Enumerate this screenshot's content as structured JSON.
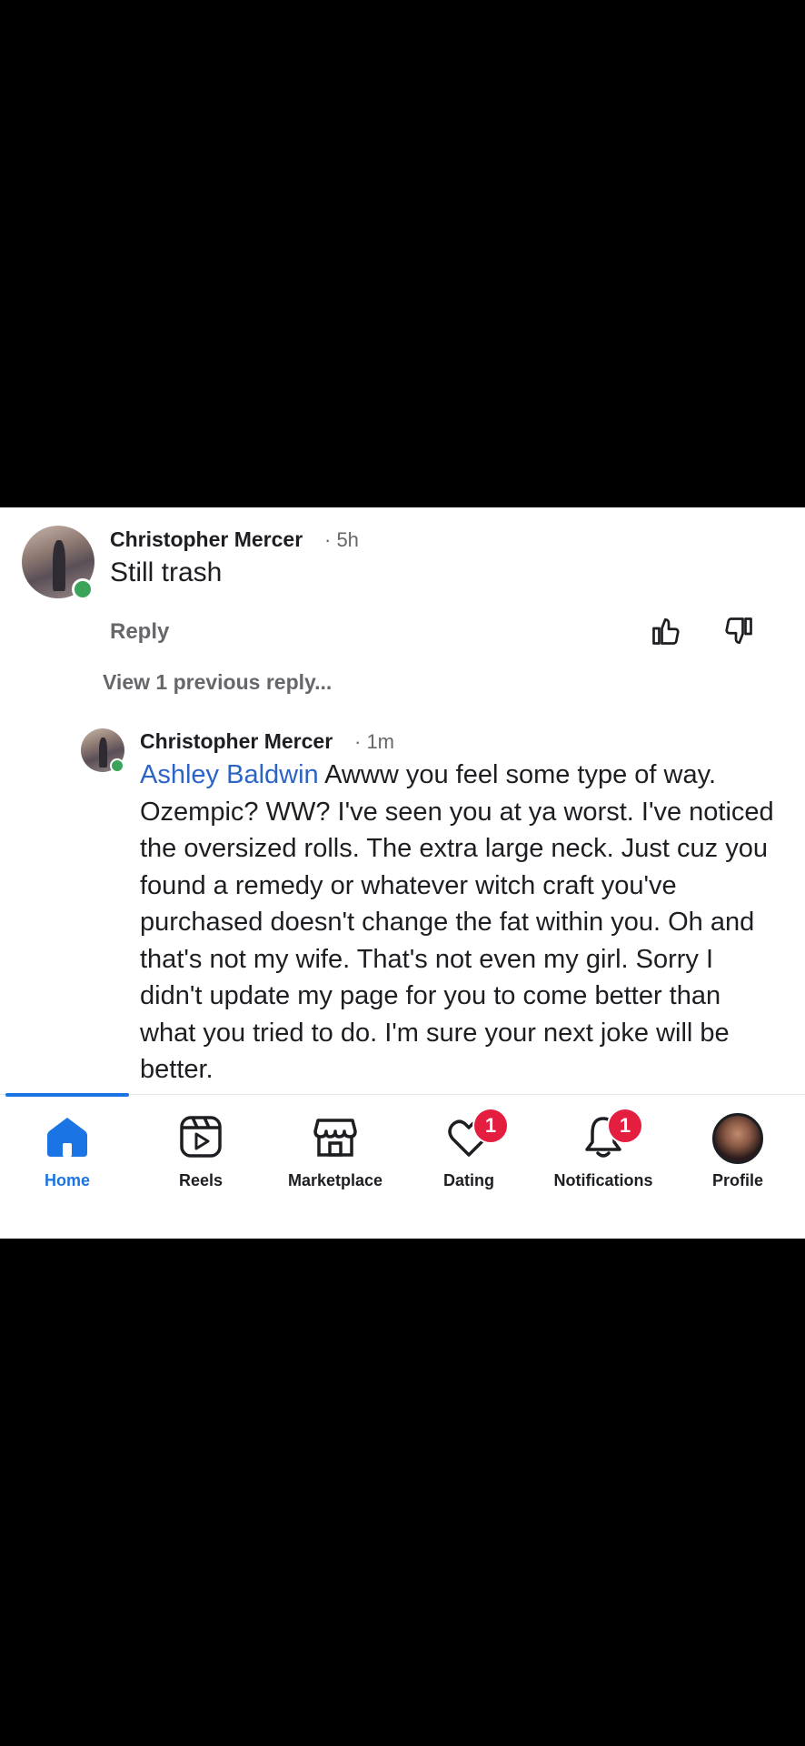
{
  "comment1": {
    "author": "Christopher Mercer",
    "time": "· 5h",
    "text": "Still trash",
    "reply_label": "Reply"
  },
  "view_previous": "View 1 previous reply...",
  "comment2": {
    "author": "Christopher Mercer",
    "time": "· 1m",
    "mention": "Ashley Baldwin",
    "text": " Awww you feel some type of way. Ozempic? WW? I've seen you at ya worst. I've noticed the oversized rolls. The extra large neck. Just cuz you found a remedy or whatever witch craft you've purchased doesn't change the fat within you.  Oh and that's not my wife. That's not even my girl. Sorry I didn't update my page for you to come better than what you tried to do. I'm sure your next joke will be better."
  },
  "nav": {
    "items": [
      {
        "label": "Home",
        "icon": "home-icon",
        "active": true
      },
      {
        "label": "Reels",
        "icon": "reels-icon"
      },
      {
        "label": "Marketplace",
        "icon": "marketplace-icon"
      },
      {
        "label": "Dating",
        "icon": "dating-icon",
        "badge": "1"
      },
      {
        "label": "Notifications",
        "icon": "bell-icon",
        "badge": "1"
      },
      {
        "label": "Profile",
        "icon": "profile-avatar"
      }
    ]
  },
  "colors": {
    "accent": "#1b74e4",
    "mention": "#2c64c6",
    "badge": "#e41e3f",
    "online": "#3aa45a"
  }
}
